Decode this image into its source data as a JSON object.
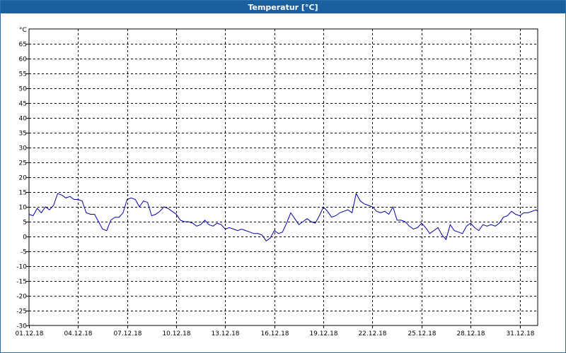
{
  "window": {
    "title": "Temperatur [°C]"
  },
  "chart_data": {
    "type": "line",
    "ylabel": "°C",
    "ylim": [
      -30,
      70
    ],
    "grid": true,
    "y_ticks": [
      -30,
      -25,
      -20,
      -15,
      -10,
      -5,
      0,
      5,
      10,
      15,
      20,
      25,
      30,
      35,
      40,
      45,
      50,
      55,
      60,
      65
    ],
    "x_tick_labels": [
      "01.12.18",
      "04.12.18",
      "07.12.18",
      "10.12.18",
      "13.12.18",
      "16.12.18",
      "19.12.18",
      "22.12.18",
      "25.12.18",
      "28.12.18",
      "31.12.18"
    ],
    "x_range_days": [
      1,
      32.1
    ],
    "line_color": "#0000aa",
    "series": [
      {
        "x": [
          1.0,
          1.25,
          1.5,
          1.75,
          2.0,
          2.25,
          2.5,
          2.75,
          3.0,
          3.25,
          3.5,
          3.75,
          4.0,
          4.25,
          4.5,
          4.75,
          5.0,
          5.25,
          5.5,
          5.75,
          6.0,
          6.25,
          6.5,
          6.75,
          7.0,
          7.25,
          7.5,
          7.75,
          8.0,
          8.25,
          8.5,
          8.75,
          9.0,
          9.25,
          9.5,
          9.75,
          10.0,
          10.25,
          10.5,
          10.75,
          11.0,
          11.25,
          11.5,
          11.75,
          12.0,
          12.25,
          12.5,
          12.75,
          13.0,
          13.25,
          13.5,
          13.75,
          14.0,
          14.25,
          14.5,
          14.75,
          15.0,
          15.25,
          15.5,
          15.75,
          16.0,
          16.25,
          16.5,
          16.75,
          17.0,
          17.25,
          17.5,
          17.75,
          18.0,
          18.25,
          18.5,
          18.75,
          19.0,
          19.25,
          19.5,
          19.75,
          20.0,
          20.25,
          20.5,
          20.75,
          21.0,
          21.25,
          21.5,
          21.75,
          22.0,
          22.25,
          22.5,
          22.75,
          23.0,
          23.25,
          23.5,
          23.75,
          24.0,
          24.25,
          24.5,
          24.75,
          25.0,
          25.25,
          25.5,
          25.75,
          26.0,
          26.25,
          26.5,
          26.75,
          27.0,
          27.25,
          27.5,
          27.75,
          28.0,
          28.25,
          28.5,
          28.75,
          29.0,
          29.25,
          29.5,
          29.75,
          30.0,
          30.25,
          30.5,
          30.75,
          31.0,
          31.25,
          31.5,
          31.75,
          32.0,
          32.1
        ],
        "y": [
          7.5,
          7.0,
          9.5,
          8.0,
          10.0,
          9.0,
          10.5,
          14.5,
          14.0,
          13.0,
          13.5,
          12.5,
          12.5,
          12.0,
          8.0,
          7.5,
          7.5,
          5.0,
          2.5,
          2.0,
          5.5,
          6.5,
          6.5,
          8.0,
          12.5,
          13.0,
          12.5,
          10.0,
          12.0,
          11.5,
          7.0,
          7.5,
          8.5,
          10.0,
          9.5,
          8.5,
          7.5,
          5.5,
          5.0,
          5.0,
          4.5,
          3.5,
          4.0,
          5.5,
          4.0,
          3.5,
          4.5,
          4.0,
          2.5,
          3.0,
          2.5,
          2.0,
          2.5,
          2.0,
          1.5,
          1.0,
          1.0,
          0.5,
          -1.5,
          -0.5,
          2.0,
          1.0,
          1.5,
          4.5,
          8.0,
          6.0,
          4.0,
          5.0,
          6.0,
          5.0,
          4.5,
          7.0,
          10.0,
          8.5,
          6.5,
          7.0,
          8.0,
          8.5,
          9.0,
          8.0,
          14.5,
          12.0,
          11.0,
          10.5,
          10.0,
          8.5,
          8.0,
          8.5,
          7.5,
          10.0,
          5.5,
          5.5,
          5.0,
          3.5,
          2.5,
          3.0,
          4.5,
          3.0,
          1.0,
          2.0,
          3.0,
          0.5,
          -1.0,
          4.0,
          2.0,
          1.5,
          1.0,
          3.5,
          4.5,
          3.0,
          2.0,
          4.0,
          3.5,
          4.0,
          3.5,
          4.5,
          6.5,
          7.0,
          8.5,
          7.5,
          7.0,
          8.0,
          8.0,
          8.5,
          9.0,
          8.5
        ]
      }
    ]
  }
}
